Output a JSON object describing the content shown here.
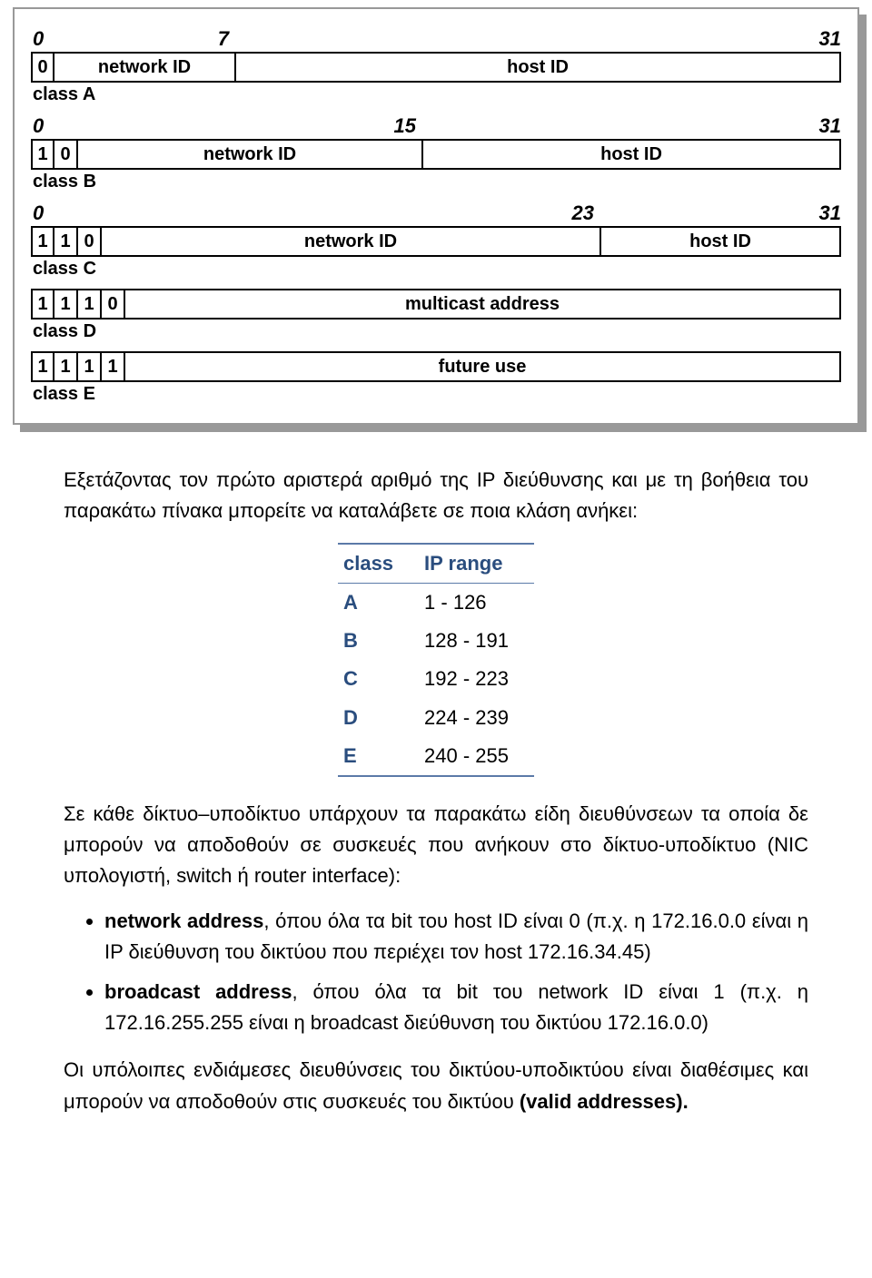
{
  "diagram": {
    "rowA": {
      "ticks": [
        "0",
        "7",
        "31"
      ],
      "bits": [
        "0"
      ],
      "fields": [
        "network ID",
        "host ID"
      ],
      "label": "class A"
    },
    "rowB": {
      "ticks": [
        "0",
        "15",
        "31"
      ],
      "bits": [
        "1",
        "0"
      ],
      "fields": [
        "network ID",
        "host ID"
      ],
      "label": "class B"
    },
    "rowC": {
      "ticks": [
        "0",
        "23",
        "31"
      ],
      "bits": [
        "1",
        "1",
        "0"
      ],
      "fields": [
        "network ID",
        "host ID"
      ],
      "label": "class C"
    },
    "rowD": {
      "bits": [
        "1",
        "1",
        "1",
        "0"
      ],
      "fields": [
        "multicast address"
      ],
      "label": "class D"
    },
    "rowE": {
      "bits": [
        "1",
        "1",
        "1",
        "1"
      ],
      "fields": [
        "future use"
      ],
      "label": "class E"
    }
  },
  "text": {
    "intro": "Εξετάζοντας τον πρώτο αριστερά αριθμό της IP διεύθυνσης και με τη βοήθεια του παρακάτω πίνακα μπορείτε να καταλάβετε σε ποια κλάση ανήκει:",
    "table": {
      "header": [
        "class",
        "IP range"
      ],
      "rows": [
        [
          "A",
          "1 - 126"
        ],
        [
          "B",
          "128 - 191"
        ],
        [
          "C",
          "192 - 223"
        ],
        [
          "D",
          "224 - 239"
        ],
        [
          "E",
          "240 - 255"
        ]
      ]
    },
    "para2": "Σε κάθε δίκτυο–υποδίκτυο υπάρχουν τα παρακάτω είδη διευθύνσεων τα οποία δε μπορούν να αποδοθούν σε συσκευές που ανήκουν στο δίκτυο-υποδίκτυο (NIC υπολογιστή, switch ή router interface):",
    "bullets": {
      "b1_strong": "network address",
      "b1_rest": ", όπου όλα τα bit του host ID είναι 0 (π.χ. η 172.16.0.0 είναι η IP διεύθυνση του δικτύου που περιέχει τον host 172.16.34.45)",
      "b2_strong": "broadcast address",
      "b2_rest": ", όπου όλα τα bit του network ID είναι 1 (π.χ. η 172.16.255.255 είναι η broadcast διεύθυνση του δικτύου 172.16.0.0)"
    },
    "para3_a": "Οι υπόλοιπες ενδιάμεσες διευθύνσεις του δικτύου-υποδικτύου είναι διαθέσιμες και μπορούν να αποδοθούν στις συσκευές του δικτύου ",
    "para3_b": "(valid addresses)."
  }
}
